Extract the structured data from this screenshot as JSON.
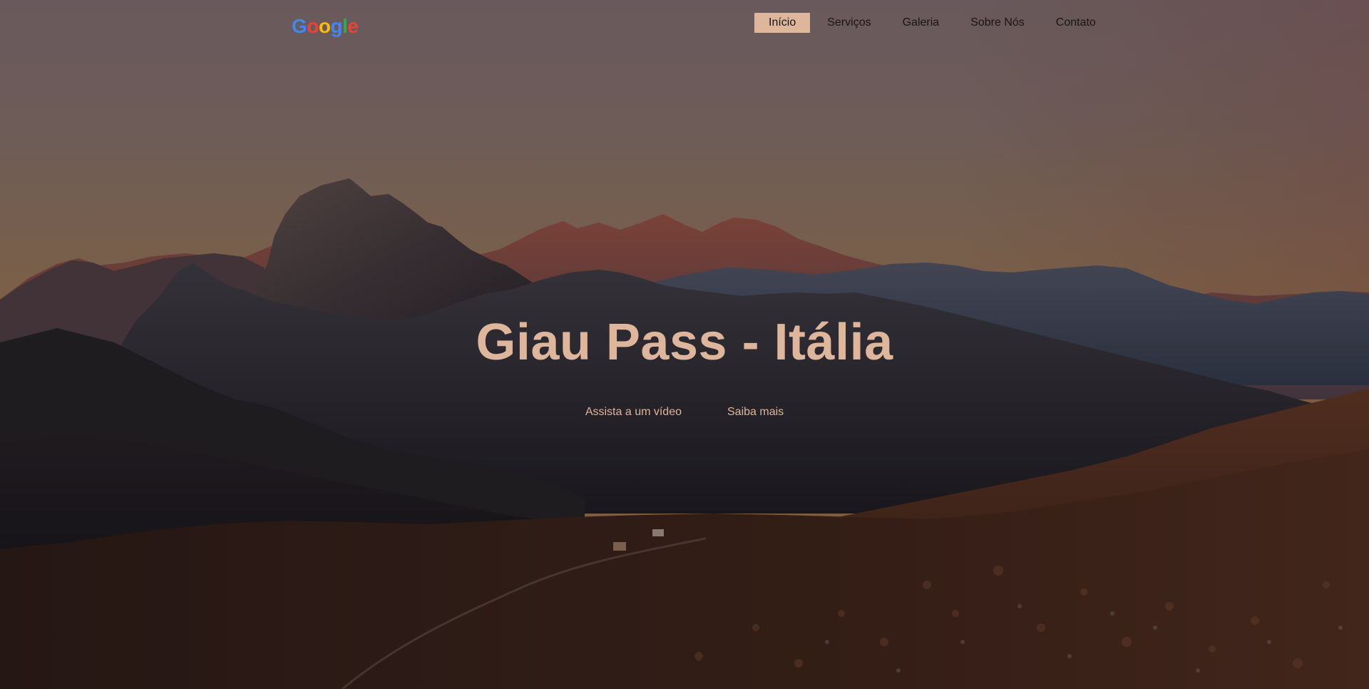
{
  "logo": {
    "letters": [
      "G",
      "o",
      "o",
      "g",
      "l",
      "e"
    ],
    "colors": [
      "#4285f4",
      "#ea4335",
      "#fbbc05",
      "#4285f4",
      "#34a853",
      "#ea4335"
    ]
  },
  "nav": {
    "items": [
      {
        "label": "Início",
        "active": true
      },
      {
        "label": "Serviços",
        "active": false
      },
      {
        "label": "Galeria",
        "active": false
      },
      {
        "label": "Sobre Nós",
        "active": false
      },
      {
        "label": "Contato",
        "active": false
      }
    ]
  },
  "hero": {
    "title": "Giau Pass - Itália",
    "watch_video": "Assista a um vídeo",
    "learn_more": "Saiba mais"
  },
  "colors": {
    "accent": "#ddb69b",
    "nav_text": "#1a1414"
  }
}
